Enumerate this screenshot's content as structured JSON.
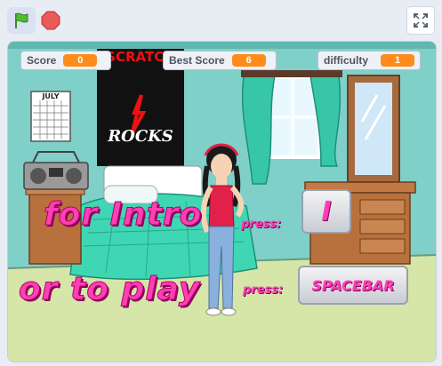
{
  "toolbar": {
    "green_flag_icon": "green-flag-icon",
    "stop_icon": "stop-sign-icon",
    "fullscreen_icon": "fullscreen-icon"
  },
  "monitors": [
    {
      "label": "Score",
      "value": "0"
    },
    {
      "label": "Best Score",
      "value": "6"
    },
    {
      "label": "difficulty",
      "value": "1"
    }
  ],
  "scene": {
    "poster_line1": "SCRATCH",
    "poster_line2": "ROCKS",
    "calendar_month": "JULY"
  },
  "overlay": {
    "line1": "for Intro",
    "line2": "or to play",
    "press1": "press:",
    "press2": "press:",
    "key1": "I",
    "key2": "SPACEBAR"
  },
  "colors": {
    "accent_orange": "#ff8c1a",
    "text_pink": "#ff3fb4",
    "wall_teal": "#7fd0c9",
    "floor_green": "#d5e6a8"
  }
}
